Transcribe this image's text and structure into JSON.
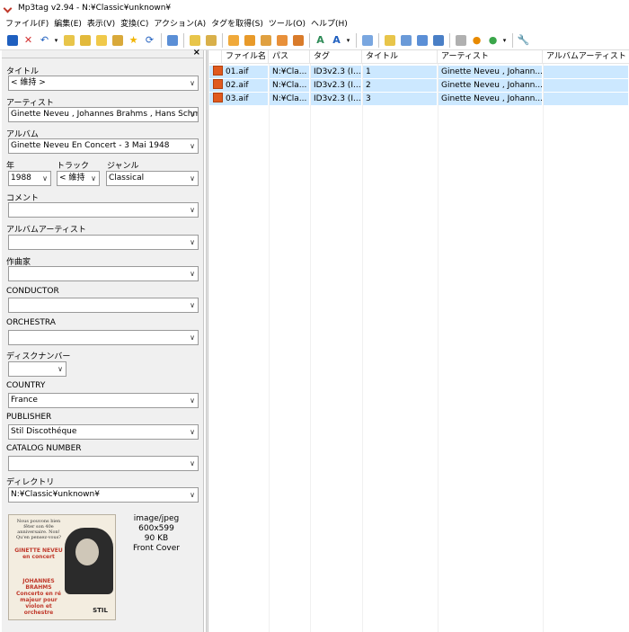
{
  "window": {
    "title": "Mp3tag v2.94  -  N:¥Classic¥unknown¥"
  },
  "menu": [
    "ファイル(F)",
    "編集(E)",
    "表示(V)",
    "変換(C)",
    "アクション(A)",
    "タグを取得(S)",
    "ツール(O)",
    "ヘルプ(H)"
  ],
  "fields": {
    "title": {
      "label": "タイトル",
      "value": "< 維持 >"
    },
    "artist": {
      "label": "アーティスト",
      "value": "Ginette Neveu , Johannes Brahms , Hans Schmi"
    },
    "album": {
      "label": "アルバム",
      "value": "Ginette Neveu En Concert - 3 Mai 1948"
    },
    "year": {
      "label": "年",
      "value": "1988"
    },
    "track": {
      "label": "トラック",
      "value": "< 維持"
    },
    "genre": {
      "label": "ジャンル",
      "value": "Classical"
    },
    "comment": {
      "label": "コメント",
      "value": ""
    },
    "album_artist": {
      "label": "アルバムアーティスト",
      "value": ""
    },
    "composer": {
      "label": "作曲家",
      "value": ""
    },
    "conductor": {
      "label": "CONDUCTOR",
      "value": ""
    },
    "orchestra": {
      "label": "ORCHESTRA",
      "value": ""
    },
    "disc_number": {
      "label": "ディスクナンバー",
      "value": ""
    },
    "country": {
      "label": "COUNTRY",
      "value": "France"
    },
    "publisher": {
      "label": "PUBLISHER",
      "value": "Stil Discothéque"
    },
    "catalog_number": {
      "label": "CATALOG NUMBER",
      "value": ""
    },
    "directory": {
      "label": "ディレクトリ",
      "value": "N:¥Classic¥unknown¥"
    }
  },
  "cover": {
    "top_text": "Nous pouvons bien fêter son 40e anniversaire. Non! Qu'en pensez-vous?",
    "red_text": "GINETTE NEVEU en concert",
    "bottom_text": "JOHANNES BRAHMS Concerto en ré majeur pour violon et orchestre",
    "logo_text": "STIL",
    "info": {
      "mime": "image/jpeg",
      "dimensions": "600x599",
      "size": "90 KB",
      "type": "Front Cover"
    }
  },
  "filelist": {
    "columns": [
      "ファイル名",
      "パス",
      "タグ",
      "タイトル",
      "アーティスト",
      "アルバムアーティスト"
    ],
    "rows": [
      {
        "filename": "01.aif",
        "path": "N:¥Cla...",
        "tag": "ID3v2.3 (I...",
        "title": "1",
        "artist": "Ginette Neveu , Johann...",
        "album_artist": ""
      },
      {
        "filename": "02.aif",
        "path": "N:¥Cla...",
        "tag": "ID3v2.3 (I...",
        "title": "2",
        "artist": "Ginette Neveu , Johann...",
        "album_artist": ""
      },
      {
        "filename": "03.aif",
        "path": "N:¥Cla...",
        "tag": "ID3v2.3 (I...",
        "title": "3",
        "artist": "Ginette Neveu , Johann...",
        "album_artist": ""
      }
    ]
  },
  "colors": {
    "selection": "#cce8ff",
    "panel_bg": "#f0f0f0",
    "file_icon": "#e05a1e"
  }
}
